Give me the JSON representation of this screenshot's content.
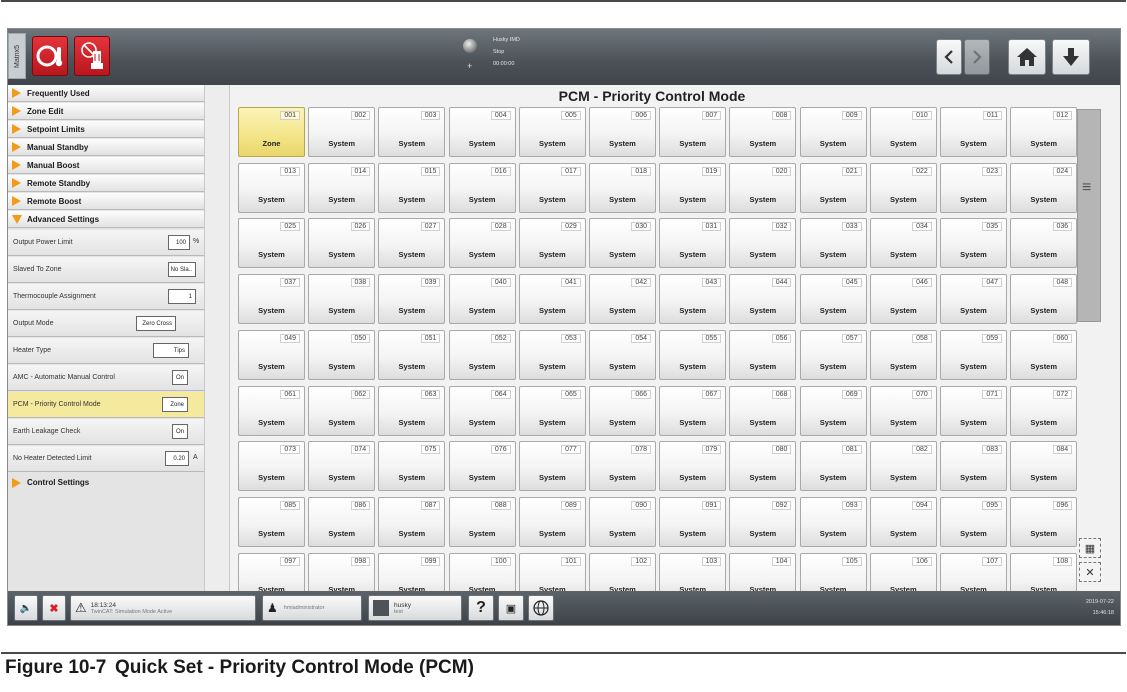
{
  "app": {
    "product_tab": "Matrix5"
  },
  "status": {
    "line1": "Husky IMD",
    "line2": "Stop",
    "line3": "00:00:00",
    "plus": "+"
  },
  "sidebar": {
    "menu": [
      {
        "label": "Frequently Used"
      },
      {
        "label": "Zone Edit"
      },
      {
        "label": "Setpoint Limits"
      },
      {
        "label": "Manual Standby"
      },
      {
        "label": "Manual Boost"
      },
      {
        "label": "Remote Standby"
      },
      {
        "label": "Remote Boost"
      },
      {
        "label": "Advanced Settings",
        "expanded": true
      }
    ],
    "settings": [
      {
        "label": "Output Power Limit",
        "value": "100",
        "unit": "%"
      },
      {
        "label": "Slaved To Zone",
        "value": "No Sla..",
        "unit": ""
      },
      {
        "label": "Thermocouple Assignment",
        "value": "1",
        "unit": ""
      },
      {
        "label": "Output Mode",
        "value": "Zero Cross",
        "unit": ""
      },
      {
        "label": "Heater Type",
        "value": "Tips",
        "unit": ""
      },
      {
        "label": "AMC - Automatic Manual Control",
        "value": "On",
        "unit": ""
      },
      {
        "label": "PCM - Priority Control Mode",
        "value": "Zone",
        "unit": "",
        "selected": true
      },
      {
        "label": "Earth Leakage Check",
        "value": "On",
        "unit": ""
      },
      {
        "label": "No Heater Detected Limit",
        "value": "0.20",
        "unit": "A"
      }
    ],
    "footer_menu": {
      "label": "Control Settings"
    }
  },
  "main": {
    "title": "PCM - Priority Control Mode",
    "tiles": [
      {
        "num": "001",
        "value": "Zone",
        "highlight": true
      },
      {
        "num": "002",
        "value": "System"
      },
      {
        "num": "003",
        "value": "System"
      },
      {
        "num": "004",
        "value": "System"
      },
      {
        "num": "005",
        "value": "System"
      },
      {
        "num": "006",
        "value": "System"
      },
      {
        "num": "007",
        "value": "System"
      },
      {
        "num": "008",
        "value": "System"
      },
      {
        "num": "009",
        "value": "System"
      },
      {
        "num": "010",
        "value": "System"
      },
      {
        "num": "011",
        "value": "System"
      },
      {
        "num": "012",
        "value": "System"
      },
      {
        "num": "013",
        "value": "System"
      },
      {
        "num": "014",
        "value": "System"
      },
      {
        "num": "015",
        "value": "System"
      },
      {
        "num": "016",
        "value": "System"
      },
      {
        "num": "017",
        "value": "System"
      },
      {
        "num": "018",
        "value": "System"
      },
      {
        "num": "019",
        "value": "System"
      },
      {
        "num": "020",
        "value": "System"
      },
      {
        "num": "021",
        "value": "System"
      },
      {
        "num": "022",
        "value": "System"
      },
      {
        "num": "023",
        "value": "System"
      },
      {
        "num": "024",
        "value": "System"
      },
      {
        "num": "025",
        "value": "System"
      },
      {
        "num": "026",
        "value": "System"
      },
      {
        "num": "027",
        "value": "System"
      },
      {
        "num": "028",
        "value": "System"
      },
      {
        "num": "029",
        "value": "System"
      },
      {
        "num": "030",
        "value": "System"
      },
      {
        "num": "031",
        "value": "System"
      },
      {
        "num": "032",
        "value": "System"
      },
      {
        "num": "033",
        "value": "System"
      },
      {
        "num": "034",
        "value": "System"
      },
      {
        "num": "035",
        "value": "System"
      },
      {
        "num": "036",
        "value": "System"
      },
      {
        "num": "037",
        "value": "System"
      },
      {
        "num": "038",
        "value": "System"
      },
      {
        "num": "039",
        "value": "System"
      },
      {
        "num": "040",
        "value": "System"
      },
      {
        "num": "041",
        "value": "System"
      },
      {
        "num": "042",
        "value": "System"
      },
      {
        "num": "043",
        "value": "System"
      },
      {
        "num": "044",
        "value": "System"
      },
      {
        "num": "045",
        "value": "System"
      },
      {
        "num": "046",
        "value": "System"
      },
      {
        "num": "047",
        "value": "System"
      },
      {
        "num": "048",
        "value": "System"
      },
      {
        "num": "049",
        "value": "System"
      },
      {
        "num": "050",
        "value": "System"
      },
      {
        "num": "051",
        "value": "System"
      },
      {
        "num": "052",
        "value": "System"
      },
      {
        "num": "053",
        "value": "System"
      },
      {
        "num": "054",
        "value": "System"
      },
      {
        "num": "055",
        "value": "System"
      },
      {
        "num": "056",
        "value": "System"
      },
      {
        "num": "057",
        "value": "System"
      },
      {
        "num": "058",
        "value": "System"
      },
      {
        "num": "059",
        "value": "System"
      },
      {
        "num": "060",
        "value": "System"
      },
      {
        "num": "061",
        "value": "System"
      },
      {
        "num": "062",
        "value": "System"
      },
      {
        "num": "063",
        "value": "System"
      },
      {
        "num": "064",
        "value": "System"
      },
      {
        "num": "065",
        "value": "System"
      },
      {
        "num": "066",
        "value": "System"
      },
      {
        "num": "067",
        "value": "System"
      },
      {
        "num": "068",
        "value": "System"
      },
      {
        "num": "069",
        "value": "System"
      },
      {
        "num": "070",
        "value": "System"
      },
      {
        "num": "071",
        "value": "System"
      },
      {
        "num": "072",
        "value": "System"
      },
      {
        "num": "073",
        "value": "System"
      },
      {
        "num": "074",
        "value": "System"
      },
      {
        "num": "075",
        "value": "System"
      },
      {
        "num": "076",
        "value": "System"
      },
      {
        "num": "077",
        "value": "System"
      },
      {
        "num": "078",
        "value": "System"
      },
      {
        "num": "079",
        "value": "System"
      },
      {
        "num": "080",
        "value": "System"
      },
      {
        "num": "081",
        "value": "System"
      },
      {
        "num": "082",
        "value": "System"
      },
      {
        "num": "083",
        "value": "System"
      },
      {
        "num": "084",
        "value": "System"
      },
      {
        "num": "085",
        "value": "System"
      },
      {
        "num": "086",
        "value": "System"
      },
      {
        "num": "087",
        "value": "System"
      },
      {
        "num": "088",
        "value": "System"
      },
      {
        "num": "089",
        "value": "System"
      },
      {
        "num": "090",
        "value": "System"
      },
      {
        "num": "091",
        "value": "System"
      },
      {
        "num": "092",
        "value": "System"
      },
      {
        "num": "093",
        "value": "System"
      },
      {
        "num": "094",
        "value": "System"
      },
      {
        "num": "095",
        "value": "System"
      },
      {
        "num": "096",
        "value": "System"
      },
      {
        "num": "097",
        "value": "System"
      },
      {
        "num": "098",
        "value": "System"
      },
      {
        "num": "099",
        "value": "System"
      },
      {
        "num": "100",
        "value": "System"
      },
      {
        "num": "101",
        "value": "System"
      },
      {
        "num": "102",
        "value": "System"
      },
      {
        "num": "103",
        "value": "System"
      },
      {
        "num": "104",
        "value": "System"
      },
      {
        "num": "105",
        "value": "System"
      },
      {
        "num": "106",
        "value": "System"
      },
      {
        "num": "107",
        "value": "System"
      },
      {
        "num": "108",
        "value": "System"
      }
    ]
  },
  "bottombar": {
    "alarm_time": "18:13:24",
    "alarm_text": "TwinCAT: Simulation Mode Active",
    "user": "hmiadministrator",
    "profile_name": "husky",
    "profile_sub": "test",
    "help": "?",
    "date": "2019-07-22",
    "time": "15:46:18"
  },
  "caption": {
    "number": "Figure 10-7",
    "text": "Quick Set - Priority Control Mode (PCM)"
  },
  "colors": {
    "accent_red": "#d3222a",
    "arrow_orange": "#f39a1c",
    "selected_yellow": "#f4e99c",
    "bar_gray": "#4b5157"
  },
  "icons": [
    "thermometer-icon",
    "no-edit-icon",
    "back-arrow-icon",
    "forward-arrow-icon",
    "home-icon",
    "download-icon",
    "mute-icon",
    "warning-icon",
    "user-icon",
    "save-profile-icon",
    "help-icon",
    "screenshot-icon",
    "globe-icon",
    "menu-icon"
  ]
}
